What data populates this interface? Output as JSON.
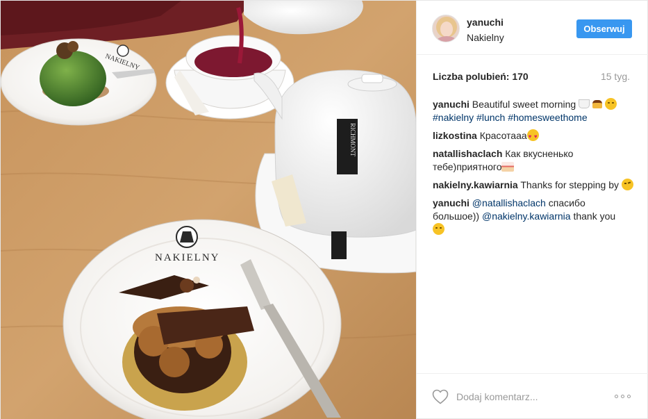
{
  "header": {
    "username": "yanuchi",
    "location": "Nakielny",
    "follow_label": "Obserwuj"
  },
  "stats": {
    "likes": "Liczba polubień: 170",
    "age": "15 tyg."
  },
  "comments": [
    {
      "user": "yanuchi",
      "text": "Beautiful sweet morning",
      "tags": [
        "#nakielny",
        "#lunch",
        "#homesweethome"
      ]
    },
    {
      "user": "lizkostina",
      "text": "Красотааа"
    },
    {
      "user": "natallishaclach",
      "text": "Как вкусненько тебе)приятного"
    },
    {
      "user": "nakielny.kawiarnia",
      "text": "Thanks for stepping by"
    },
    {
      "user": "yanuchi",
      "mention1": "@natallishaclach",
      "text": "спасибо большое))",
      "mention2": "@nakielny.kawiarnia",
      "text2": "thank you"
    }
  ],
  "photo": {
    "brand_text_large": "NAKIELNY",
    "brand_text_small": "NAKIELNY",
    "teapot_label": "RICHMONT"
  },
  "footer": {
    "comment_placeholder": "Dodaj komentarz..."
  },
  "colors": {
    "follow_button": "#3897f0",
    "link": "#003569",
    "muted": "#999999"
  },
  "icons": [
    "heart-icon",
    "more-options-icon"
  ]
}
